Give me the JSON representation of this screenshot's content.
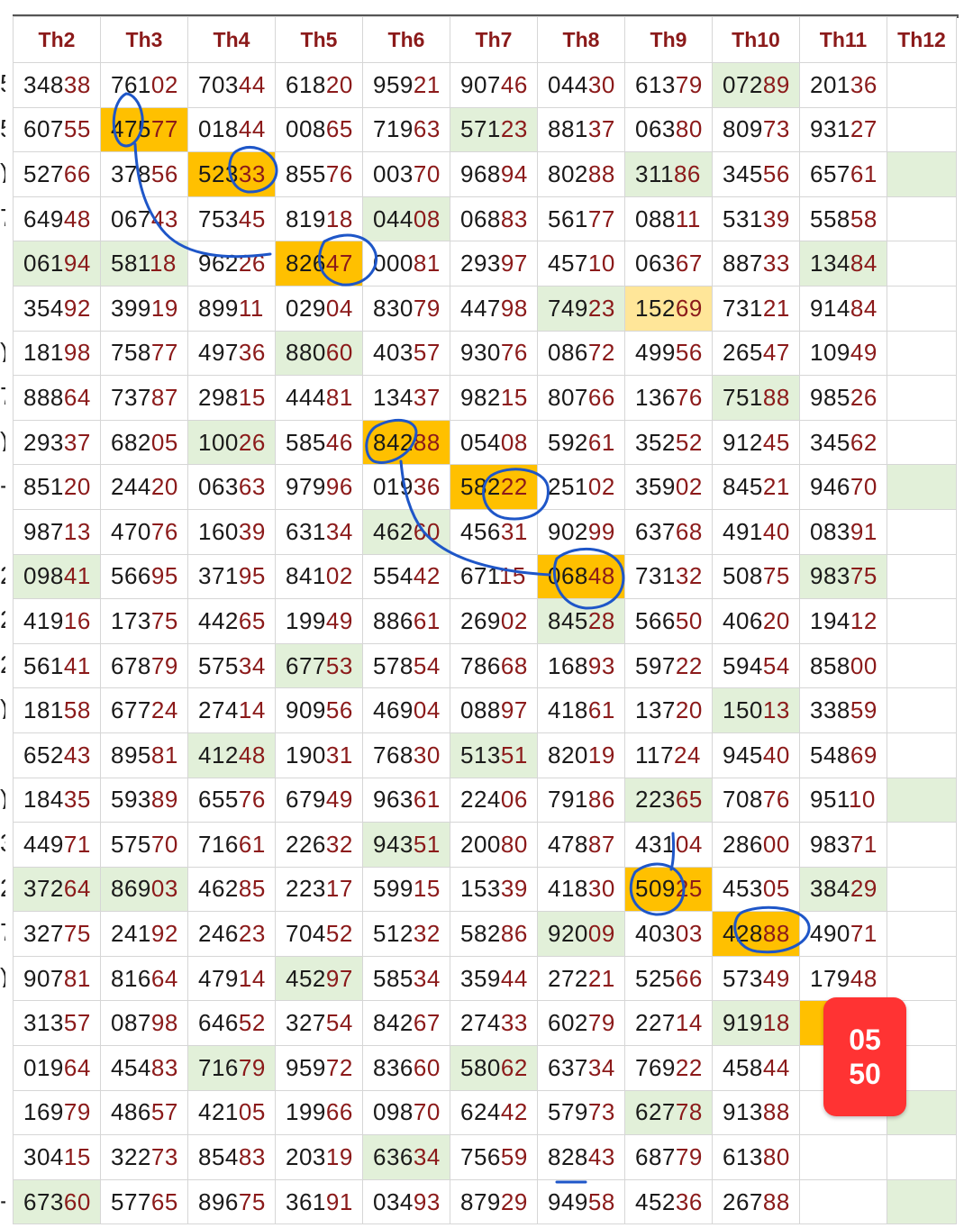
{
  "headers": [
    "Th2",
    "Th3",
    "Th4",
    "Th5",
    "Th6",
    "Th7",
    "Th8",
    "Th9",
    "Th10",
    "Th11",
    "Th12"
  ],
  "rows": [
    [
      "34838",
      "76102",
      "70344",
      "61820",
      "95921",
      "90746",
      "04430",
      "61379",
      "07289",
      "20136",
      ""
    ],
    [
      "60755",
      "47577",
      "01844",
      "00865",
      "71963",
      "57123",
      "88137",
      "06380",
      "80973",
      "93127",
      ""
    ],
    [
      "52766",
      "37856",
      "52333",
      "85576",
      "00370",
      "96894",
      "80288",
      "31186",
      "34556",
      "65761",
      ""
    ],
    [
      "64948",
      "06743",
      "75345",
      "81918",
      "04408",
      "06883",
      "56177",
      "08811",
      "53139",
      "55858",
      ""
    ],
    [
      "06194",
      "58118",
      "96226",
      "82647",
      "00081",
      "29397",
      "45710",
      "06367",
      "88733",
      "13484",
      ""
    ],
    [
      "35492",
      "39919",
      "89911",
      "02904",
      "83079",
      "44798",
      "74923",
      "15269",
      "73121",
      "91484",
      ""
    ],
    [
      "18198",
      "75877",
      "49736",
      "88060",
      "40357",
      "93076",
      "08672",
      "49956",
      "26547",
      "10949",
      ""
    ],
    [
      "88864",
      "73787",
      "29815",
      "44481",
      "13437",
      "98215",
      "80766",
      "13676",
      "75188",
      "98526",
      ""
    ],
    [
      "29337",
      "68205",
      "10026",
      "58546",
      "84288",
      "05408",
      "59261",
      "35252",
      "91245",
      "34562",
      ""
    ],
    [
      "85120",
      "24420",
      "06363",
      "97996",
      "01936",
      "58222",
      "25102",
      "35902",
      "84521",
      "94670",
      ""
    ],
    [
      "98713",
      "47076",
      "16039",
      "63134",
      "46260",
      "45631",
      "90299",
      "63768",
      "49140",
      "08391",
      ""
    ],
    [
      "09841",
      "56695",
      "37195",
      "84102",
      "55442",
      "67115",
      "06848",
      "73132",
      "50875",
      "98375",
      ""
    ],
    [
      "41916",
      "17375",
      "44265",
      "19949",
      "88661",
      "26902",
      "84528",
      "56650",
      "40620",
      "19412",
      ""
    ],
    [
      "56141",
      "67879",
      "57534",
      "67753",
      "57854",
      "78668",
      "16893",
      "59722",
      "59454",
      "85800",
      ""
    ],
    [
      "18158",
      "67724",
      "27414",
      "90956",
      "46904",
      "08897",
      "41861",
      "13720",
      "15013",
      "33859",
      ""
    ],
    [
      "65243",
      "89581",
      "41248",
      "19031",
      "76830",
      "51351",
      "82019",
      "11724",
      "94540",
      "54869",
      ""
    ],
    [
      "18435",
      "59389",
      "65576",
      "67949",
      "96361",
      "22406",
      "79186",
      "22365",
      "70876",
      "95110",
      ""
    ],
    [
      "44971",
      "57570",
      "71661",
      "22632",
      "94351",
      "20080",
      "47887",
      "43104",
      "28600",
      "98371",
      ""
    ],
    [
      "37264",
      "86903",
      "46285",
      "22317",
      "59915",
      "15339",
      "41830",
      "50925",
      "45305",
      "38429",
      ""
    ],
    [
      "32775",
      "24192",
      "24623",
      "70452",
      "51232",
      "58286",
      "92009",
      "40303",
      "42888",
      "49071",
      ""
    ],
    [
      "90781",
      "81664",
      "47914",
      "45297",
      "58534",
      "35944",
      "27221",
      "52566",
      "57349",
      "17948",
      ""
    ],
    [
      "31357",
      "08798",
      "64652",
      "32754",
      "84267",
      "27433",
      "60279",
      "22714",
      "91918",
      "",
      ""
    ],
    [
      "01964",
      "45483",
      "71679",
      "95972",
      "83660",
      "58062",
      "63734",
      "76922",
      "45844",
      "",
      ""
    ],
    [
      "16979",
      "48657",
      "42105",
      "19966",
      "09870",
      "62442",
      "57973",
      "62778",
      "91388",
      "",
      ""
    ],
    [
      "30415",
      "32273",
      "85483",
      "20319",
      "63634",
      "75659",
      "82843",
      "68779",
      "61380",
      "",
      ""
    ],
    [
      "67360",
      "57765",
      "89675",
      "36191",
      "03493",
      "87929",
      "94958",
      "45236",
      "26788",
      "",
      ""
    ]
  ],
  "highlights": {
    "green": [
      [
        0,
        8
      ],
      [
        1,
        5
      ],
      [
        2,
        7
      ],
      [
        2,
        10
      ],
      [
        3,
        4
      ],
      [
        4,
        0
      ],
      [
        4,
        1
      ],
      [
        4,
        9
      ],
      [
        5,
        6
      ],
      [
        6,
        3
      ],
      [
        7,
        8
      ],
      [
        8,
        2
      ],
      [
        9,
        10
      ],
      [
        10,
        4
      ],
      [
        11,
        0
      ],
      [
        11,
        9
      ],
      [
        12,
        6
      ],
      [
        13,
        3
      ],
      [
        14,
        8
      ],
      [
        15,
        2
      ],
      [
        15,
        5
      ],
      [
        16,
        7
      ],
      [
        16,
        10
      ],
      [
        17,
        4
      ],
      [
        18,
        0
      ],
      [
        18,
        1
      ],
      [
        18,
        9
      ],
      [
        19,
        6
      ],
      [
        20,
        3
      ],
      [
        21,
        8
      ],
      [
        22,
        2
      ],
      [
        22,
        5
      ],
      [
        23,
        7
      ],
      [
        23,
        10
      ],
      [
        24,
        4
      ],
      [
        25,
        0
      ],
      [
        25,
        10
      ]
    ],
    "orange": [
      [
        1,
        1
      ],
      [
        2,
        2
      ],
      [
        4,
        3
      ],
      [
        8,
        4
      ],
      [
        9,
        5
      ],
      [
        11,
        6
      ],
      [
        18,
        7
      ],
      [
        19,
        8
      ],
      [
        21,
        9
      ]
    ],
    "lightyellow": [
      [
        5,
        7
      ]
    ]
  },
  "badge": {
    "line1": "05",
    "line2": "50"
  },
  "left_marks": [
    "5",
    "5",
    ")",
    "7",
    "",
    "",
    ")",
    "7",
    ")",
    "-",
    "",
    "2",
    "2",
    "2",
    ")",
    "",
    ")",
    "3",
    "2",
    "7",
    ")",
    "",
    "",
    "",
    "",
    "-"
  ]
}
